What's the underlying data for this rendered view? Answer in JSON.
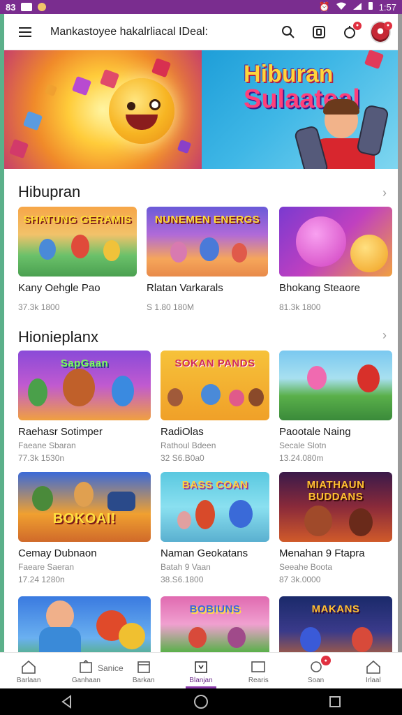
{
  "status_bar": {
    "time": "1:57",
    "left_text": "83"
  },
  "app_bar": {
    "search_text": "Mankastoyee hakalrliacal IDeal:"
  },
  "hero": {
    "title_line1": "Hiburan",
    "title_line2": "Sulaateal"
  },
  "sections": [
    {
      "title": "Hibupran",
      "cards": [
        {
          "name": "Kany Oehgle Pao",
          "meta": "37.3k 1800",
          "thumb_text": "SHATUNG GERAMIS"
        },
        {
          "name": "Rlatan Varkarals",
          "meta": "S 1.80 180M",
          "thumb_text": "NUNEMEN ENERGS"
        },
        {
          "name": "Bhokang Steaore",
          "meta": "81.3k 1800",
          "thumb_text": ""
        }
      ]
    },
    {
      "title": "Hionieplanx",
      "cards": [
        {
          "name": "Raehasr Sotimper",
          "sub": "Faeane Sbaran",
          "meta": "77.3k 1530n",
          "thumb_text": "SapGaan"
        },
        {
          "name": "RadiOlas",
          "sub": "Rathoul Bdeen",
          "meta": "32 S6.B0a0",
          "thumb_text": "SOKAN PANDS"
        },
        {
          "name": "Paootale Naing",
          "sub": "Secale Slotn",
          "meta": "13.24.080m",
          "thumb_text": ""
        },
        {
          "name": "Cemay Dubnaon",
          "sub": "Faeare Saeran",
          "meta": "17.24 1280n",
          "thumb_text": "BOKOAI!"
        },
        {
          "name": "Naman Geokatans",
          "sub": "Batah 9 Vaan",
          "meta": "38.S6.1800",
          "thumb_text": "BASS COAN"
        },
        {
          "name": "Menahan 9 Ftapra",
          "sub": "Seeahe Boota",
          "meta": "87 3k.0000",
          "thumb_text": "MIATHAUN BUDDANS"
        },
        {
          "name": "",
          "sub": "",
          "meta": "",
          "thumb_text": ""
        },
        {
          "name": "",
          "sub": "",
          "meta": "",
          "thumb_text": "BOBIUNS"
        },
        {
          "name": "",
          "sub": "",
          "meta": "",
          "thumb_text": "MAKANS"
        }
      ]
    }
  ],
  "service_label": "Sanice",
  "bottom_nav": [
    {
      "label": "Barlaan"
    },
    {
      "label": "Ganhaan"
    },
    {
      "label": "Barkan"
    },
    {
      "label": "Blanjan"
    },
    {
      "label": "Rearis"
    },
    {
      "label": "Soan"
    },
    {
      "label": "Irlaal"
    }
  ],
  "colors": {
    "status_bar": "#7a2d8f",
    "accent": "#8a3aaa",
    "badge": "#e03040"
  }
}
